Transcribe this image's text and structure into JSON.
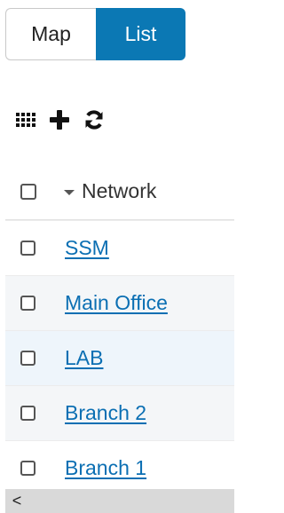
{
  "view_toggle": {
    "map_label": "Map",
    "list_label": "List",
    "active": "List"
  },
  "toolbar": {
    "icons": [
      "grid-icon",
      "plus-icon",
      "refresh-icon"
    ]
  },
  "table": {
    "column_header": "Network",
    "sort": "descending",
    "rows": [
      {
        "name": "SSM"
      },
      {
        "name": "Main Office"
      },
      {
        "name": "LAB"
      },
      {
        "name": "Branch 2"
      },
      {
        "name": "Branch 1"
      }
    ]
  },
  "scrollbar": {
    "left_arrow": "<"
  },
  "colors": {
    "accent": "#0b78b4",
    "link": "#0b6fb3"
  }
}
